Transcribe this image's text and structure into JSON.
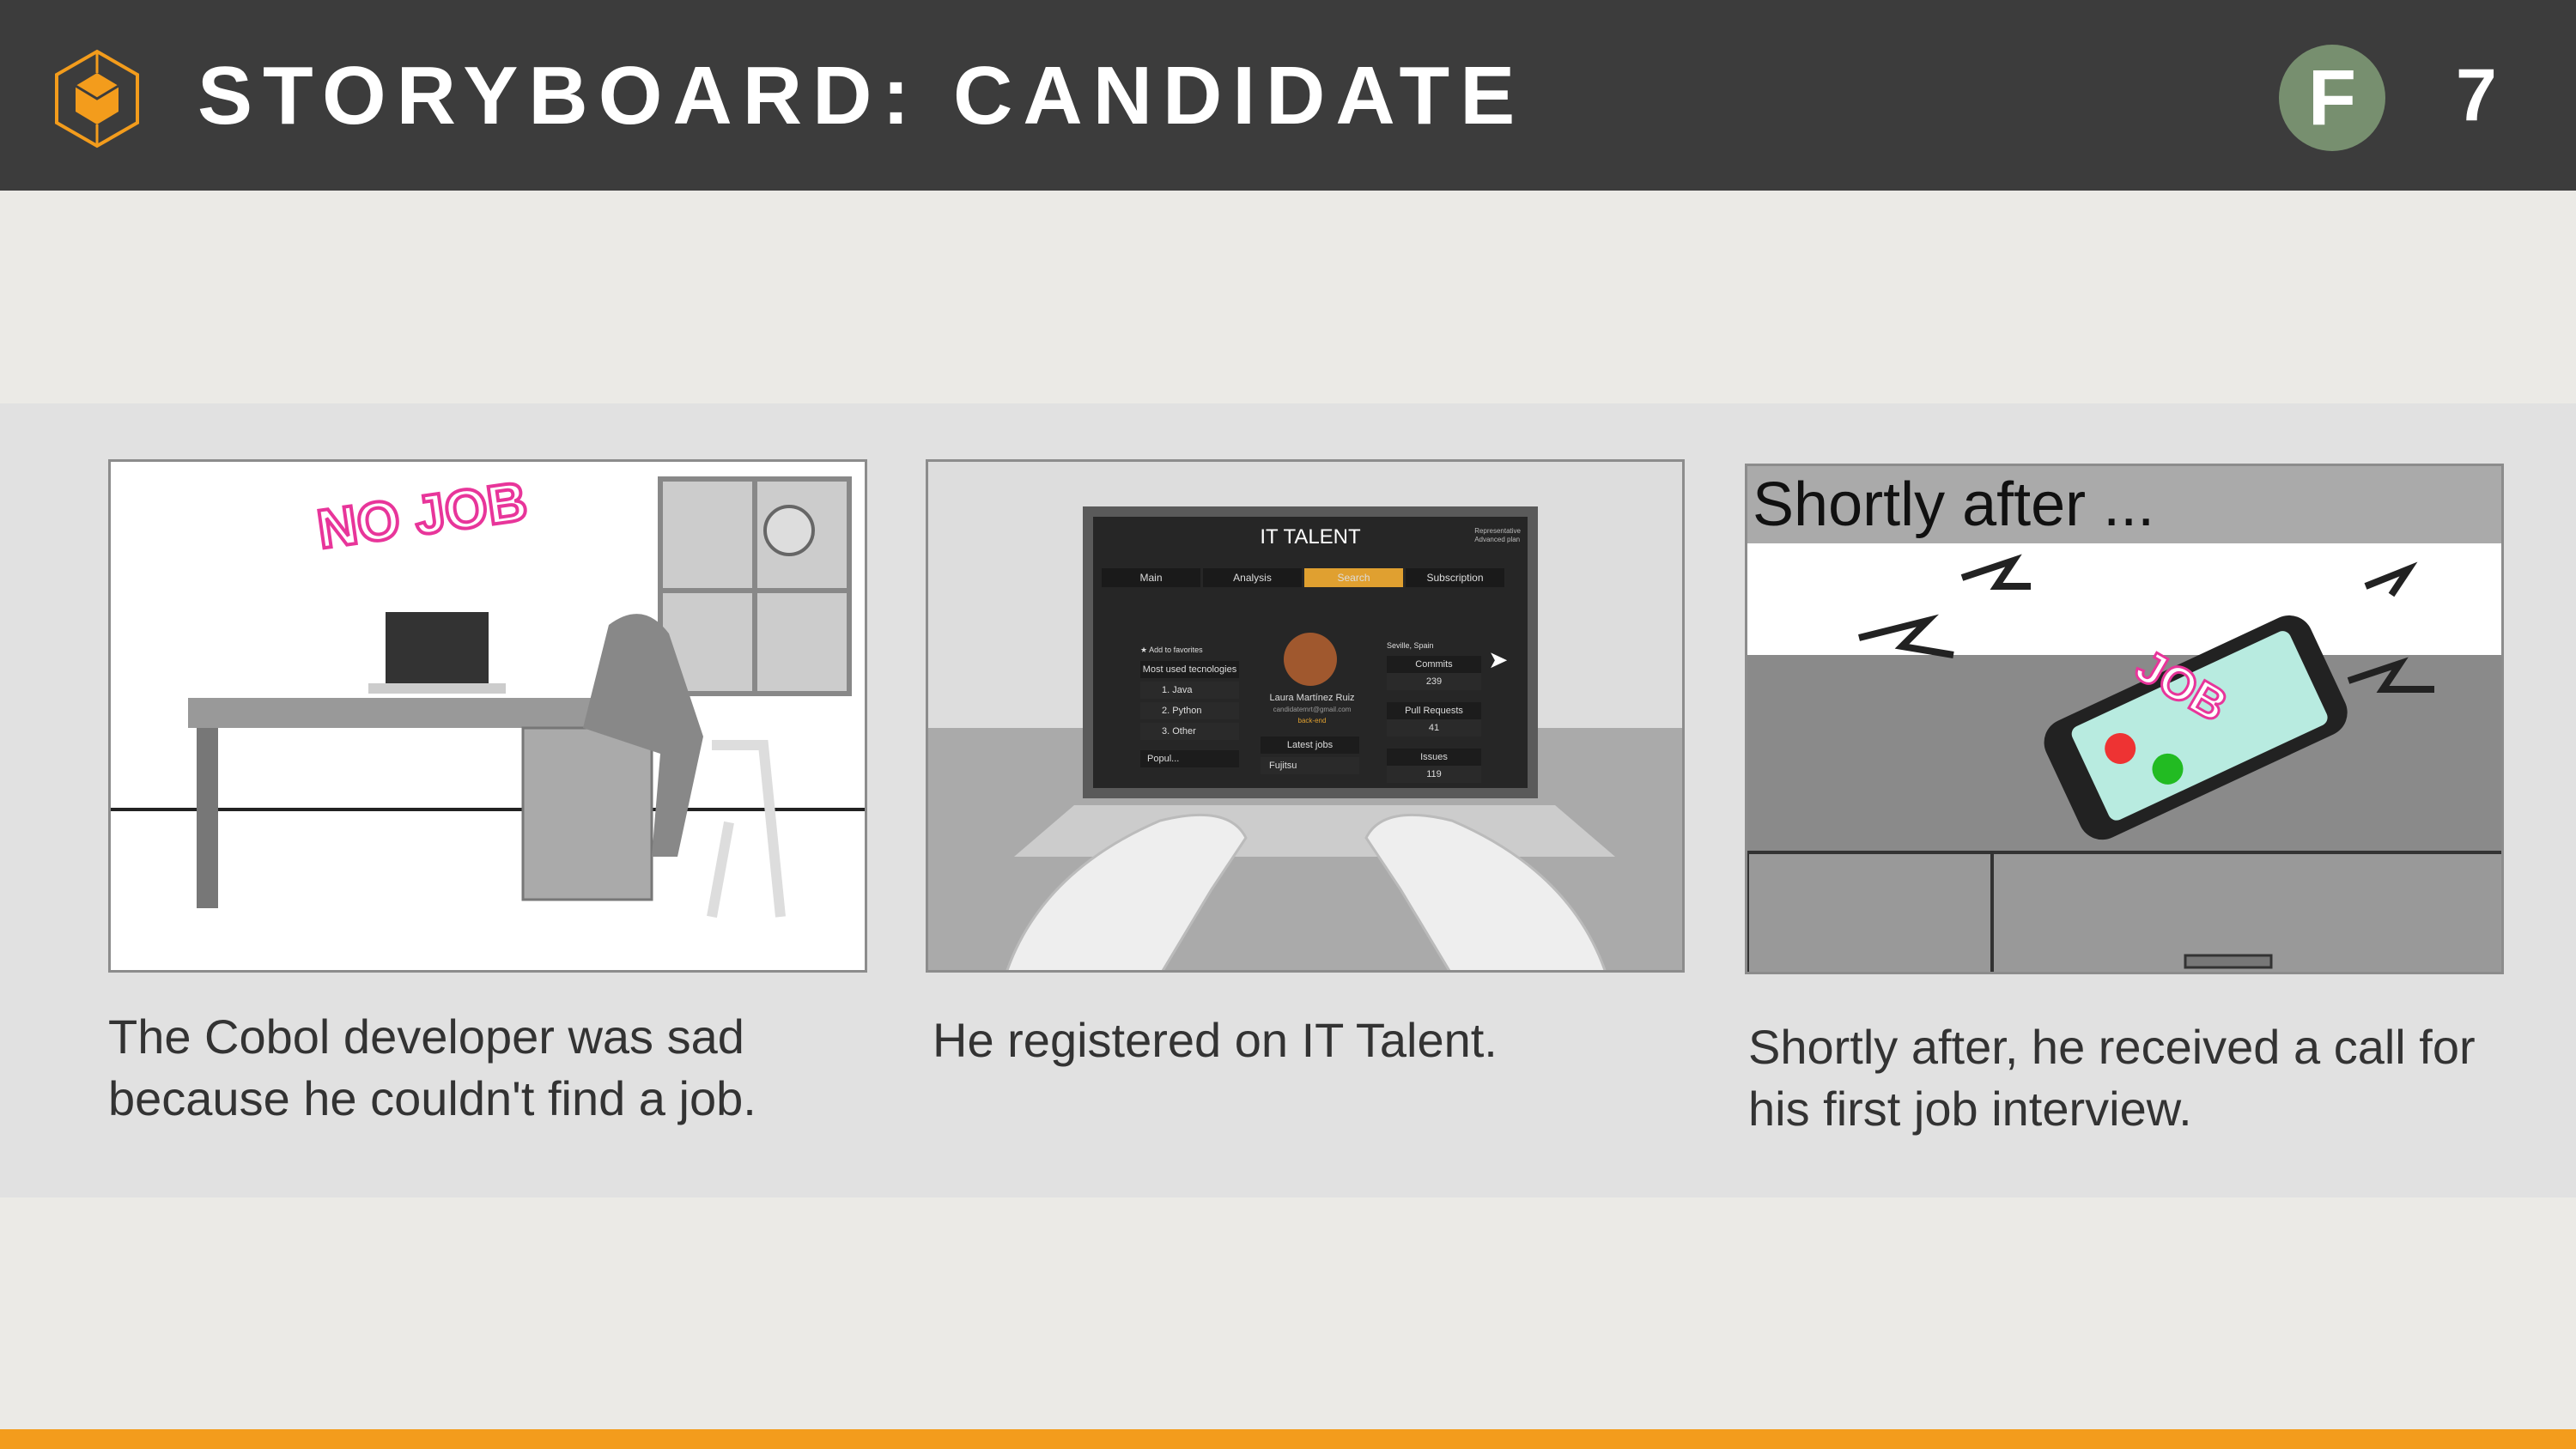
{
  "header": {
    "title": "STORYBOARD: CANDIDATE",
    "badge": "F",
    "page_number": "7",
    "logo_icon": "hexagon-cube-icon"
  },
  "colors": {
    "header_bg": "#3c3c3c",
    "accent": "#f39c1c",
    "badge": "#778f6f"
  },
  "panels": [
    {
      "image_text": "NO JOB",
      "caption": "The Cobol developer was sad because he couldn't find a job."
    },
    {
      "caption": "He registered on IT Talent.",
      "screen": {
        "app_title": "IT TALENT",
        "user_role": "Representative",
        "user_plan": "Advanced plan",
        "tabs": [
          "Main",
          "Analysis",
          "Search",
          "Subscription"
        ],
        "favorites": "Add to favorites",
        "tech_header": "Most used tecnologies",
        "techs": [
          "1. Java",
          "2. Python",
          "3. Other"
        ],
        "popular": "Popul...",
        "name": "Laura Martínez Ruiz",
        "email": "candidatemrt@gmail.com",
        "role": "back-end",
        "jobs_header": "Latest jobs",
        "job": "Fujitsu",
        "location": "Seville, Spain",
        "stats": [
          {
            "label": "Commits",
            "value": "239"
          },
          {
            "label": "Pull Requests",
            "value": "41"
          },
          {
            "label": "Issues",
            "value": "119"
          }
        ]
      }
    },
    {
      "image_heading": "Shortly after ...",
      "image_text": "JOB",
      "caption": "Shortly after, he received a call for his first job interview."
    }
  ]
}
